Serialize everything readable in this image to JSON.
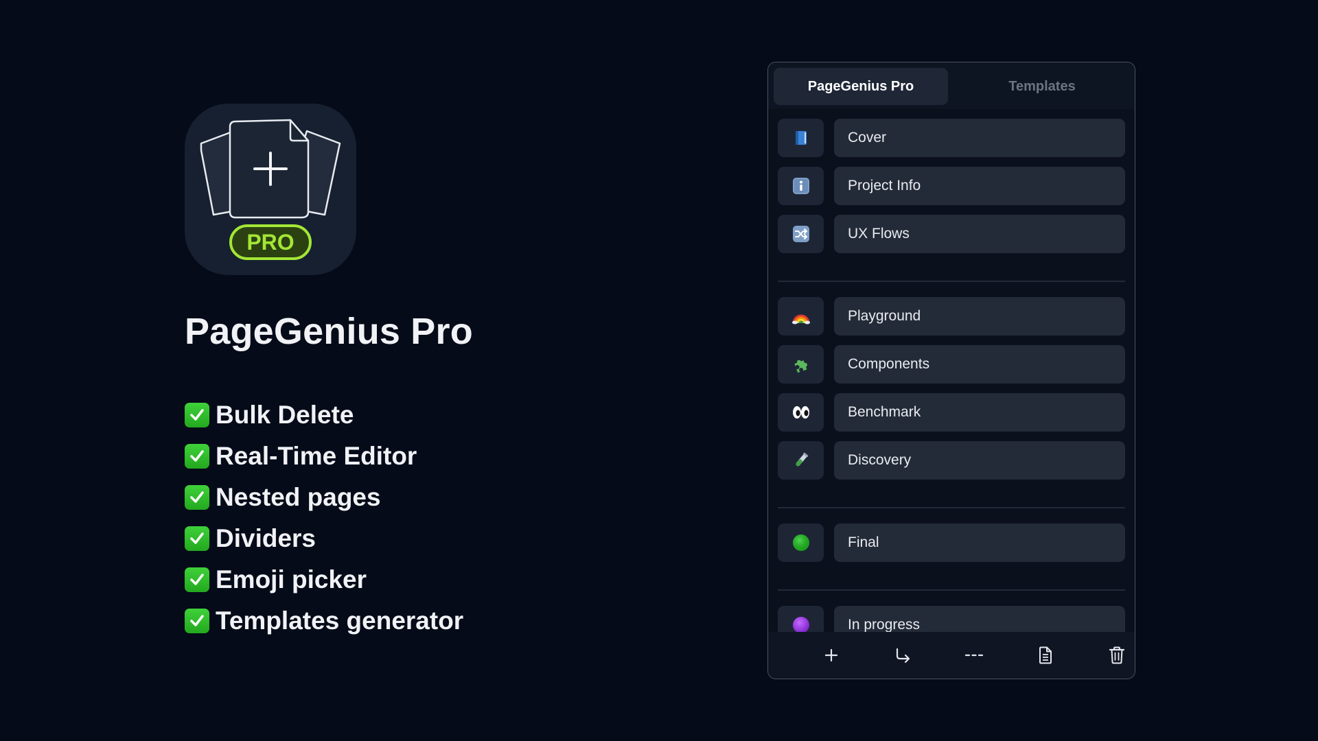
{
  "app": {
    "title": "PageGenius Pro",
    "badge_label": "PRO",
    "icon": "document-stack-plus-icon"
  },
  "features": [
    {
      "label": "Bulk Delete"
    },
    {
      "label": "Real-Time Editor"
    },
    {
      "label": "Nested pages"
    },
    {
      "label": "Dividers"
    },
    {
      "label": "Emoji picker"
    },
    {
      "label": "Templates generator"
    }
  ],
  "panel": {
    "tabs": [
      {
        "label": "PageGenius Pro",
        "active": true
      },
      {
        "label": "Templates",
        "active": false
      }
    ],
    "pages": [
      {
        "label": "Cover",
        "emoji": "📘"
      },
      {
        "label": "Project Info",
        "emoji": "ℹ️"
      },
      {
        "label": "UX Flows",
        "emoji": "🔀"
      },
      {
        "label": "Playground",
        "emoji": "🌈"
      },
      {
        "label": "Components",
        "emoji": "🧩"
      },
      {
        "label": "Benchmark",
        "emoji": "👀"
      },
      {
        "label": "Discovery",
        "emoji": "🧪"
      },
      {
        "label": "Final",
        "emoji": "🟢"
      },
      {
        "label": "In progress",
        "emoji": "🟣"
      }
    ],
    "toolbar": [
      {
        "name": "add-page-icon"
      },
      {
        "name": "nested-page-icon"
      },
      {
        "name": "divider-icon"
      },
      {
        "name": "document-icon"
      },
      {
        "name": "trash-icon"
      }
    ]
  },
  "colors": {
    "background": "#050b18",
    "accent_green": "#9be22f",
    "check_green": "#2fbf2a",
    "panel_border": "#4b5261"
  }
}
